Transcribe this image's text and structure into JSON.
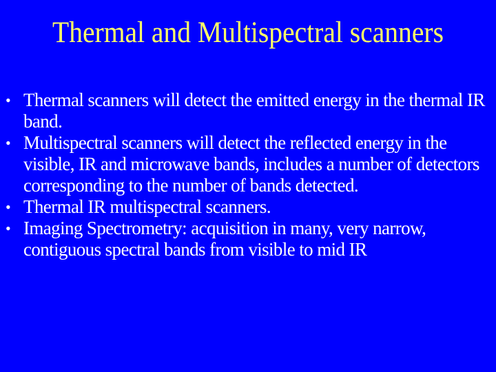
{
  "slide": {
    "title": "Thermal and Multispectral scanners",
    "colors": {
      "background": "#0000ff",
      "title": "#ffff66",
      "body": "#ffffff"
    },
    "bullets": [
      {
        "text": "Thermal scanners will detect the emitted energy in the thermal IR band."
      },
      {
        "text": "Multispectral scanners will detect the reflected energy in the visible, IR and microwave bands, includes a number of detectors corresponding to the number of bands detected."
      },
      {
        "text": "Thermal IR multispectral scanners."
      },
      {
        "text": "Imaging Spectrometry: acquisition in many, very narrow, contiguous spectral bands from visible to mid IR"
      }
    ],
    "bullet_glyph": "•"
  }
}
